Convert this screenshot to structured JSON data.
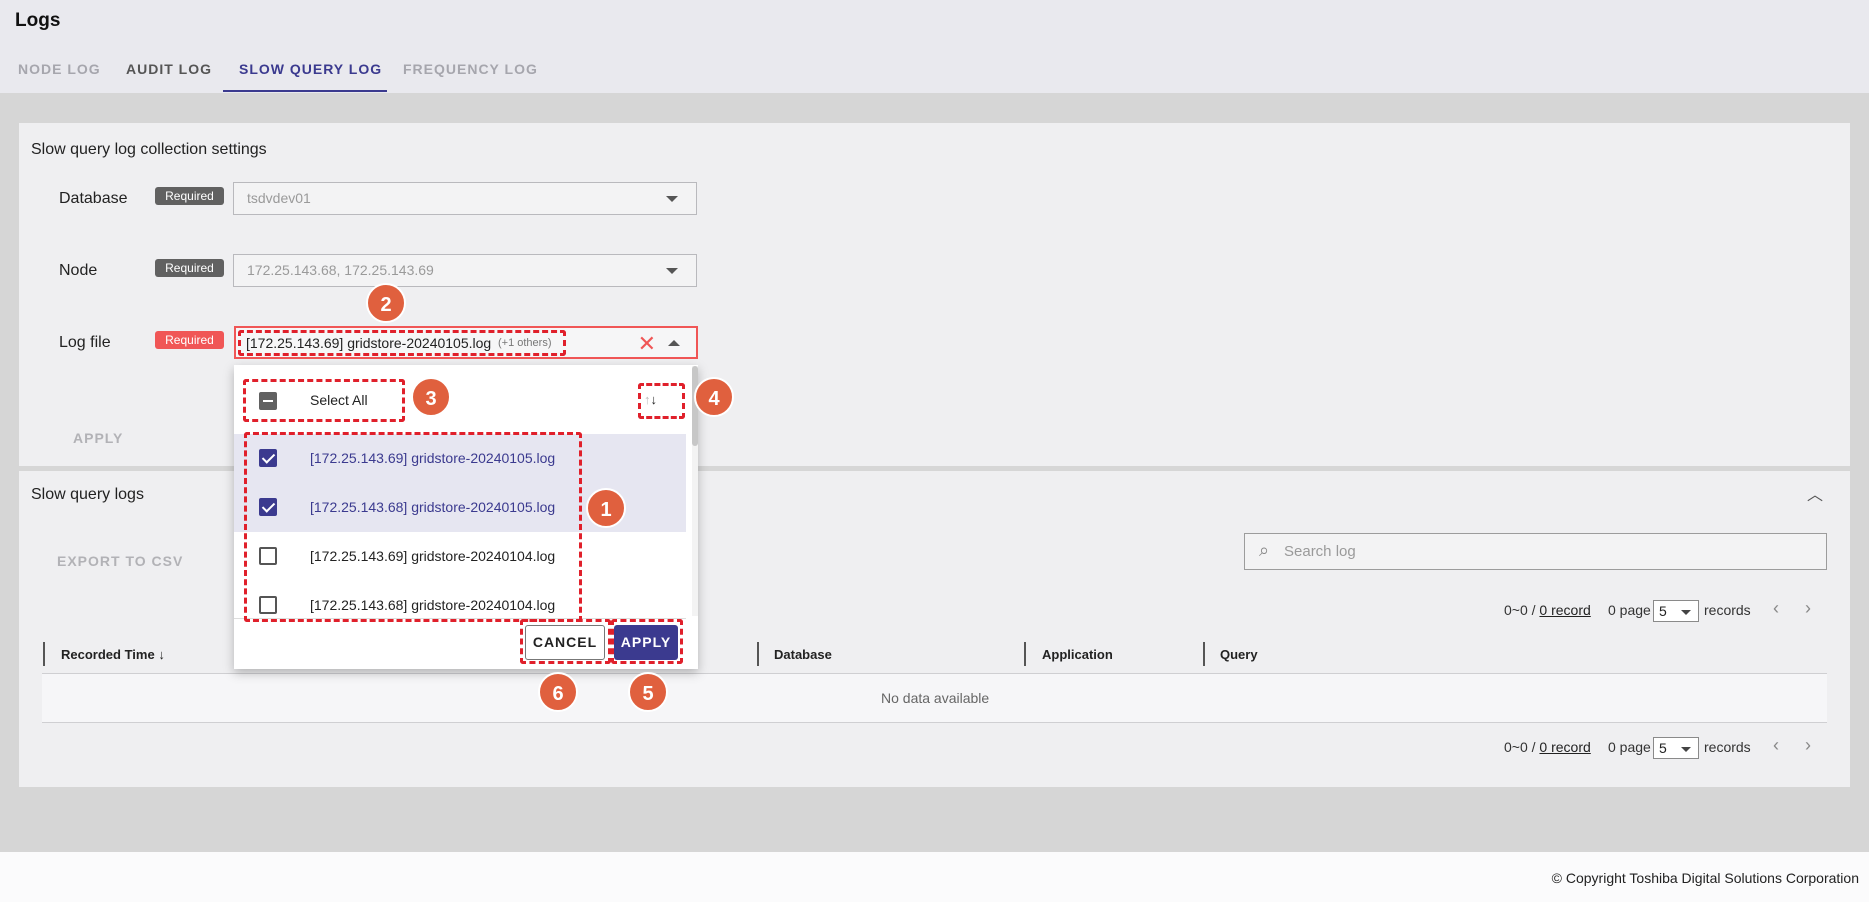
{
  "header": {
    "title": "Logs",
    "tabs": [
      {
        "label": "NODE LOG",
        "state": "disabled"
      },
      {
        "label": "AUDIT LOG",
        "state": "normal"
      },
      {
        "label": "SLOW QUERY LOG",
        "state": "active"
      },
      {
        "label": "FREQUENCY LOG",
        "state": "disabled"
      }
    ]
  },
  "settings": {
    "title": "Slow query log collection settings",
    "required_label": "Required",
    "database": {
      "label": "Database",
      "value": "tsdvdev01"
    },
    "node": {
      "label": "Node",
      "value": "172.25.143.68, 172.25.143.69"
    },
    "logfile": {
      "label": "Log file",
      "value": "[172.25.143.69] gridstore-20240105.log",
      "more": "(+1 others)"
    },
    "apply_label": "APPLY"
  },
  "dropdown": {
    "select_all": "Select All",
    "items": [
      {
        "label": "[172.25.143.69] gridstore-20240105.log",
        "checked": true
      },
      {
        "label": "[172.25.143.68] gridstore-20240105.log",
        "checked": true
      },
      {
        "label": "[172.25.143.69] gridstore-20240104.log",
        "checked": false
      },
      {
        "label": "[172.25.143.68] gridstore-20240104.log",
        "checked": false
      }
    ],
    "cancel_label": "CANCEL",
    "apply_label": "APPLY"
  },
  "annotations": [
    "1",
    "2",
    "3",
    "4",
    "5",
    "6"
  ],
  "logs": {
    "title": "Slow query logs",
    "export_label": "EXPORT TO CSV",
    "search_placeholder": "Search log",
    "columns": [
      "Recorded Time",
      "Database",
      "Application",
      "Query"
    ],
    "sort_arrow": "↓",
    "empty_text": "No data available",
    "pager": {
      "range": "0~0 / ",
      "records_link": "0 record",
      "pages": "0 page",
      "per_page": "5",
      "records_label": "records"
    }
  },
  "footer": {
    "copyright": "© Copyright Toshiba Digital Solutions Corporation"
  },
  "colors": {
    "accent": "#3b3a8f",
    "error": "#f05656",
    "annotation": "#e0202b",
    "annotation_badge": "#e0603e"
  }
}
